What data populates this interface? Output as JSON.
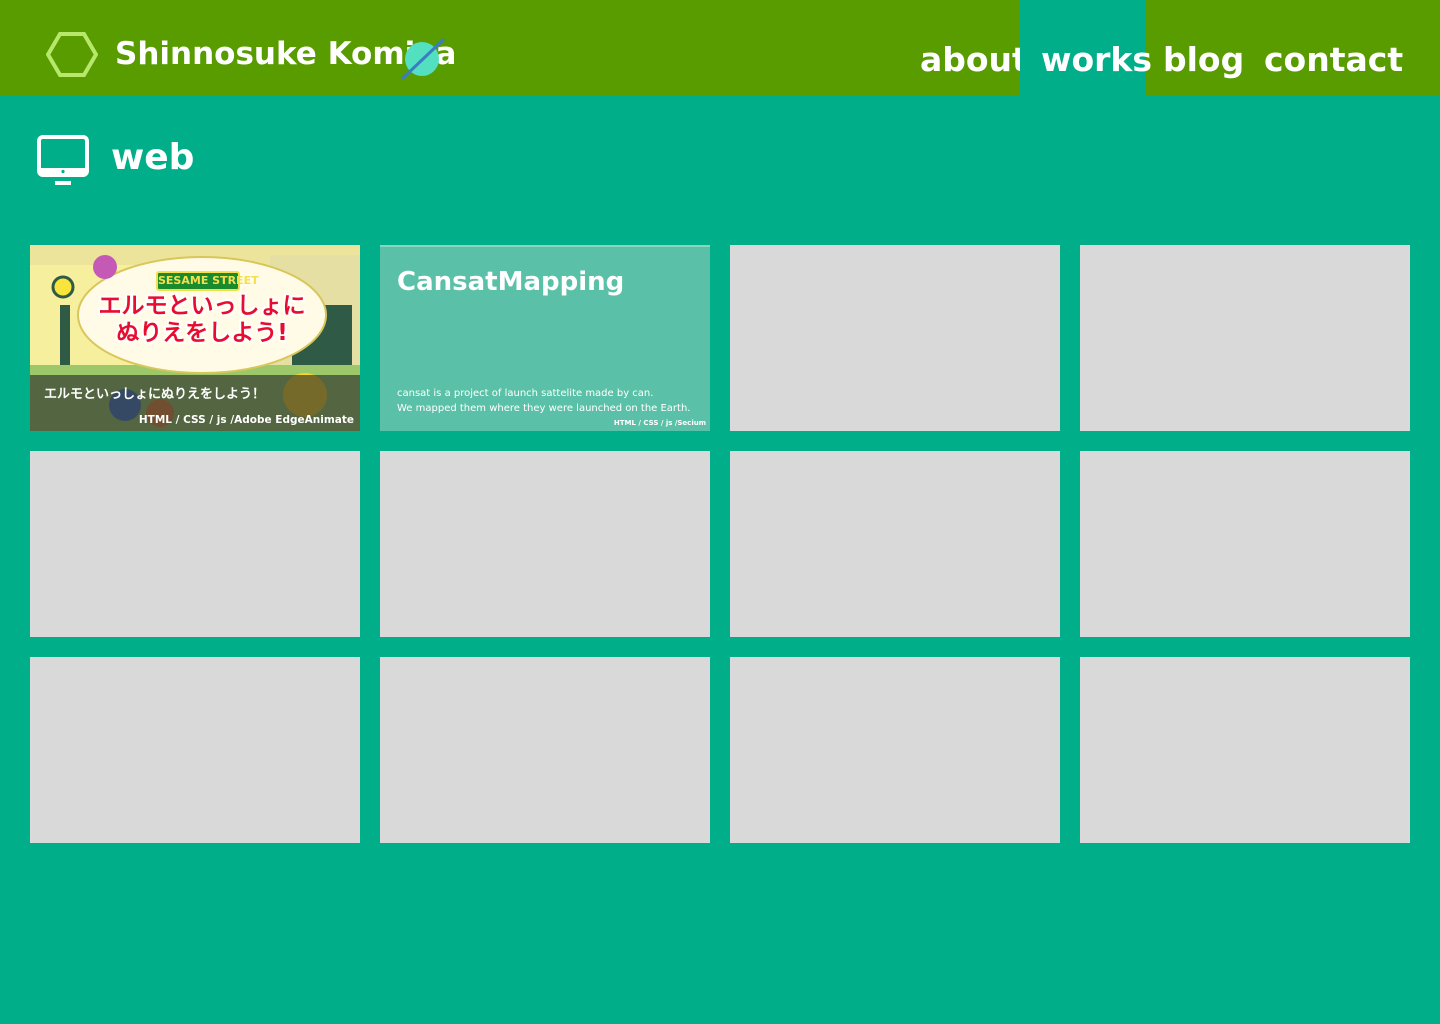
{
  "header": {
    "site_title": "Shinnosuke Komiya",
    "logo_icon": "hexagon-logo-icon",
    "decoration_icon": "planet-icon",
    "nav": [
      {
        "label": "about",
        "active": false
      },
      {
        "label": "works",
        "active": true
      },
      {
        "label": "blog",
        "active": false
      },
      {
        "label": "contact",
        "active": false
      }
    ]
  },
  "section": {
    "icon": "monitor-icon",
    "title": "web"
  },
  "works": [
    {
      "caption": "エルモといっしょにぬりえをしよう！",
      "tech": "HTML / CSS / js /Adobe EdgeAnimate",
      "image_logo": "SESAME STREET",
      "image_headline_line1": "エルモといっしょに",
      "image_headline_line2": "ぬりえをしよう!"
    },
    {
      "title": "CansatMapping",
      "description_line1": "cansat is a project of launch sattelite made by can.",
      "description_line2": "We mapped them where they were launched on the Earth.",
      "tech": "HTML / CSS / js /Secium"
    }
  ],
  "colors": {
    "header_bg": "#589c00",
    "page_bg": "#00af8a",
    "placeholder_card": "#d9d9d9",
    "cansat_card": "#5ac1a8",
    "hexagon": "#b8e86b",
    "planet": "#52e0c0"
  }
}
